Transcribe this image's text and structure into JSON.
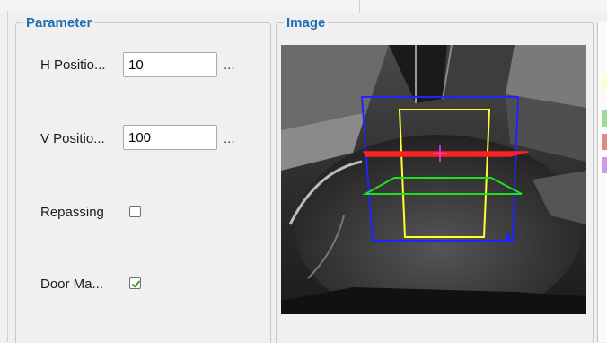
{
  "parameter": {
    "title": "Parameter",
    "h_position": {
      "label": "H Positio...",
      "value": "10",
      "more": "..."
    },
    "v_position": {
      "label": "V Positio...",
      "value": "100",
      "more": "..."
    },
    "repassing": {
      "label": "Repassing",
      "checked": false
    },
    "door_mask": {
      "label": "Door Ma...",
      "checked": true
    }
  },
  "image": {
    "title": "Image",
    "overlay_colors": {
      "outer_region": "#2222ff",
      "inner_region": "#ffff33",
      "horizontal_line": "#ff2020",
      "floor_region": "#22dd22",
      "center_marker": "#ff33ff"
    }
  },
  "side_swatches": [
    "#ffffcc",
    "#99dd99",
    "#e08888",
    "#cc99ee"
  ]
}
